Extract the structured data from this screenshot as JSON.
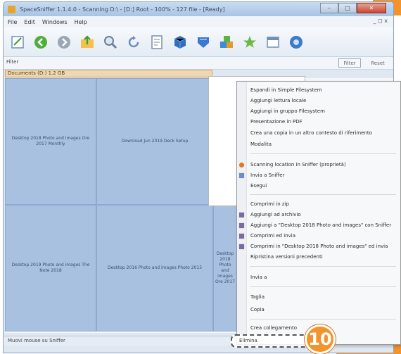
{
  "window": {
    "title": "SpaceSniffer 1.1.4.0 - Scanning D:\\ - [D:] Root - 100% - 127 file - [Ready]",
    "controls": {
      "minimize": "–",
      "maximize": "□",
      "close": "✕"
    }
  },
  "menubar": {
    "items": [
      "File",
      "Edit",
      "Windows",
      "Help"
    ],
    "right_controls": "_ ◻ x"
  },
  "toolbar": {
    "icons": [
      "new-scan-icon",
      "back-icon",
      "forward-icon",
      "folder-up-icon",
      "zoom-icon",
      "refresh-icon",
      "document-icon",
      "blue-box-icon",
      "blue-shield-icon",
      "puzzle-icon",
      "star-icon",
      "window-icon",
      "settings-icon"
    ]
  },
  "filterbar": {
    "label": "Filter",
    "filter_button": "Filter",
    "reset_button": "Reset"
  },
  "grid": {
    "header": "Documents (D:) 1.2 GB",
    "cells": [
      "Desktop 2018 Photo and images  Ore 2017 Monthly",
      "Download Jun 2019 Deck Setup",
      "Desktop 2019 Photo and images  The Note 2018",
      "Desktop 2016 Photo and images  Photo 2015",
      "Desktop 2018 Photo and images  Ore 2017"
    ]
  },
  "context_menu": {
    "items": [
      "Espandi in Simple Filesystem",
      "Aggiungi lettura locale",
      "Aggiungi in gruppo Filesystem",
      "Presentazione in PDF",
      "Crea una copia in un altro contesto di riferimento",
      "Modalita",
      "Scanning location in Sniffer (proprietà)",
      "Invia a Sniffer",
      "Esegui",
      "Comprimi in zip",
      "Aggiungi ad archivio",
      "Aggiungi a \"Desktop 2018 Photo and images\" con Sniffer",
      "Comprimi ed invia",
      "Comprimi in \"Desktop 2018 Photo and images\" ed invia",
      "Ripristina versioni precedenti",
      "Invia a",
      "Taglia",
      "Copia",
      "Crea collegamento",
      "Elimina"
    ],
    "highlighted_item": "Elimina"
  },
  "statusbar": {
    "text": "Muovi mouse su Sniffer"
  },
  "callout": {
    "step_number": "10"
  },
  "colors": {
    "accent": "#f3932c",
    "tile": "#a9c1e1",
    "header": "#efd8b0"
  }
}
